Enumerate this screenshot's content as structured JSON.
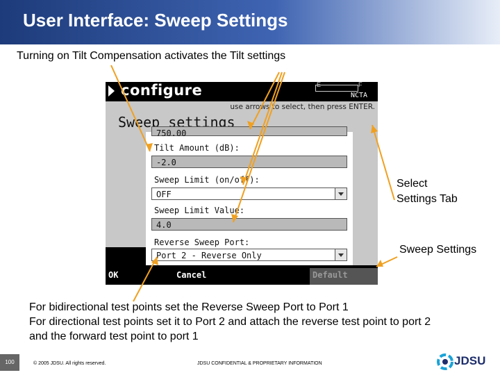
{
  "slide": {
    "title": "User Interface:  Sweep Settings",
    "intro": "Turning on Tilt Compensation activates the Tilt settings",
    "callout_tab": [
      "Select",
      "Settings Tab"
    ],
    "callout_sweep": "Sweep Settings",
    "bottom_lines": [
      "For bidirectional test points set the Reverse Sweep Port to Port 1",
      "For directional test points set it to Port 2 and attach the reverse test point to port 2",
      "and the forward test point to port 1"
    ],
    "page_number": "100",
    "copyright": "© 2005 JDSU. All rights reserved.",
    "confidential": "JDSU CONFIDENTIAL & PROPRIETARY INFORMATION",
    "logo_text": "JDSU"
  },
  "device": {
    "screen_title": "configure",
    "battery_e": "E",
    "battery_f": "F",
    "standard": "NCTA",
    "hint": "use arrows to select, then press ENTER.",
    "tab_label": "Sweep settings",
    "partial_value": "750.00",
    "fields": [
      {
        "label": "Tilt Amount (dB):",
        "value": "-2.0"
      },
      {
        "label": "Sweep Limit (on/off):",
        "value": "OFF"
      },
      {
        "label": "Sweep Limit Value:",
        "value": "4.0"
      },
      {
        "label": "Reverse Sweep Port:",
        "value": "Port 2 - Reverse Only"
      }
    ],
    "softkeys": {
      "ok": "OK",
      "cancel": "Cancel",
      "default": "Default"
    }
  },
  "colors": {
    "title_bar": "#1d3b7a",
    "arrow": "#f0a020",
    "logo": "#1d2e6b"
  }
}
